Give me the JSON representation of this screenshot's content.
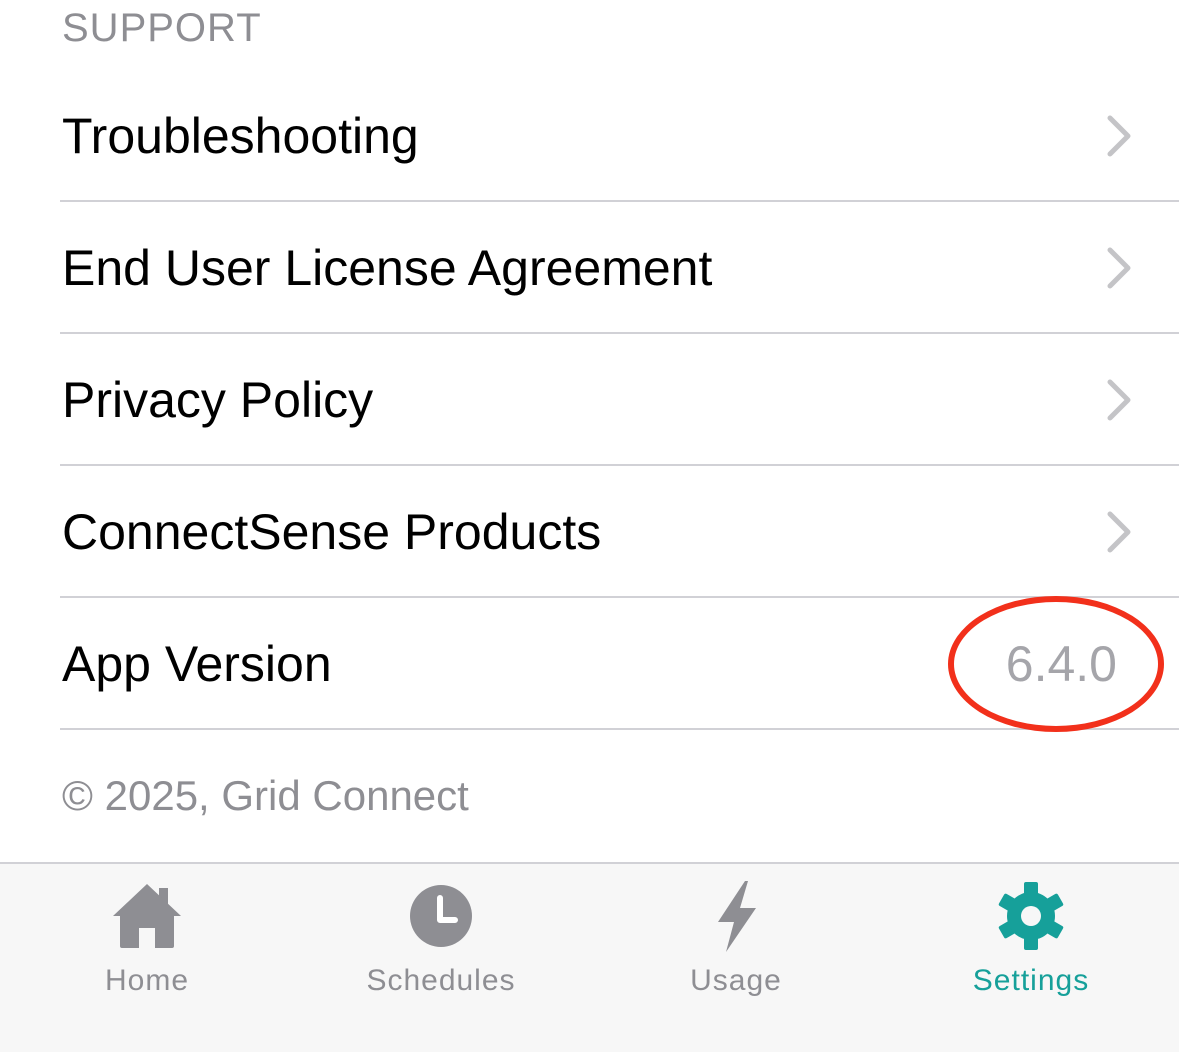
{
  "section": {
    "header": "SUPPORT"
  },
  "rows": [
    {
      "label": "Troubleshooting"
    },
    {
      "label": "End User License Agreement"
    },
    {
      "label": "Privacy Policy"
    },
    {
      "label": "ConnectSense Products"
    },
    {
      "label": "App Version",
      "value": "6.4.0"
    }
  ],
  "footer": {
    "copyright": "© 2025, Grid Connect"
  },
  "tabbar": {
    "tabs": [
      {
        "label": "Home",
        "icon": "home-icon",
        "active": false
      },
      {
        "label": "Schedules",
        "icon": "clock-icon",
        "active": false
      },
      {
        "label": "Usage",
        "icon": "lightning-bolt-icon",
        "active": false
      },
      {
        "label": "Settings",
        "icon": "gear-icon",
        "active": true
      }
    ]
  },
  "colors": {
    "accent": "#16a09a",
    "inactive_tab": "#8e8e93",
    "annotation": "#f2301b",
    "chevron": "#c4c4c7",
    "secondary_text": "#8e8e93"
  }
}
